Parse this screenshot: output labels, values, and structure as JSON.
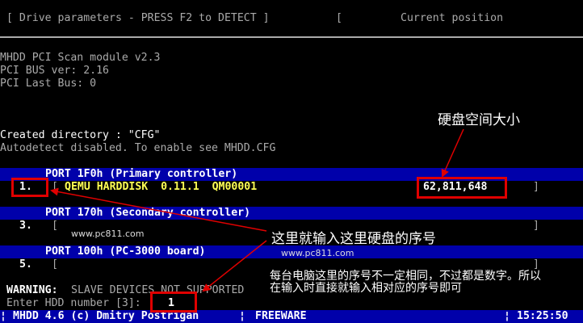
{
  "header": {
    "drive_params": "[ Drive parameters - PRESS F2 to DETECT ]",
    "bracket": "[",
    "current_position": "Current position"
  },
  "log": {
    "line1": "MHDD PCI Scan module v2.3",
    "line2": "PCI BUS ver: 2.16",
    "line3": "PCI Last Bus: 0",
    "line4": "Created directory : \"CFG\"",
    "line5": "Autodetect disabled. To enable see MHDD.CFG"
  },
  "ports": [
    {
      "title": "PORT 1F0h (Primary controller)",
      "num": "1.",
      "open": "[",
      "device": "QEMU HARDDISK  0.11.1  QM00001",
      "size": "62,811,648",
      "close": "]"
    },
    {
      "title": "PORT 170h (Secondary controller)",
      "num": "3.",
      "open": "[",
      "close": "]"
    },
    {
      "title": "PORT 100h (PC-3000 board)",
      "num": "5.",
      "open": "[",
      "close": "]"
    }
  ],
  "warning": {
    "label": "WARNING:",
    "text": "SLAVE DEVICES NOT SUPPORTED"
  },
  "prompt": {
    "label": "Enter HDD number [3]:",
    "value": "1"
  },
  "status_bar": {
    "app": "MHDD 4.6 (c) Dmitry Postrigan",
    "sep1": "¦",
    "sep2": "¦",
    "edition": "FREEWARE",
    "sep3": "¦",
    "time": "15:25:50"
  },
  "annotations": {
    "size_note": "硬盘空间大小",
    "input_note": "这里就输入这里硬盘的序号",
    "explain_line1": "每台电脑这里的序号不一定相同，不过都是数字。所以",
    "explain_line2": "在输入时直接就输入相对应的序号即可",
    "watermark1": "www.pc811.com",
    "watermark2": "www.pc811.com"
  },
  "colors": {
    "background": "#000000",
    "band": "#0000aa",
    "text": "#aaaaaa",
    "highlight": "#ffff55",
    "annotation_red": "#e00000"
  }
}
